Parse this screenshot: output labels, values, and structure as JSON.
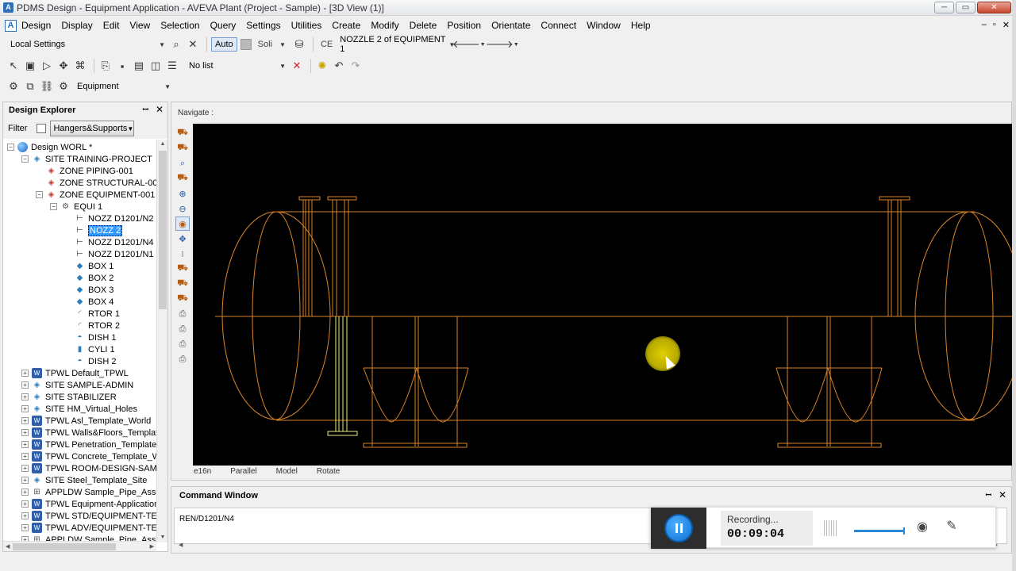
{
  "window": {
    "title": "PDMS Design - Equipment Application - AVEVA Plant (Project - Sample) - [3D View (1)]",
    "app_icon": "A",
    "buttons": {
      "minimize": "─",
      "maximize": "▭",
      "close": "✕"
    }
  },
  "menu": {
    "items": [
      "Design",
      "Display",
      "Edit",
      "View",
      "Selection",
      "Query",
      "Settings",
      "Utilities",
      "Create",
      "Modify",
      "Delete",
      "Position",
      "Orientate",
      "Connect",
      "Window",
      "Help"
    ],
    "mdi_buttons": [
      "–",
      "▫",
      "✕"
    ]
  },
  "toolbar1": {
    "settings_combo": "Local Settings",
    "auto_label": "Auto",
    "solid_label": "Soli",
    "ce_label": "CE",
    "ce_value": "NOZZLE 2 of EQUIPMENT 1"
  },
  "toolbar2": {
    "list_combo": "No list"
  },
  "toolbar3": {
    "application_combo": "Equipment"
  },
  "explorer": {
    "title": "Design Explorer",
    "pin": "📌",
    "close": "✕",
    "filter_label": "Filter",
    "filter_value": "Hangers&Supports",
    "tree": [
      {
        "label": "Design WORL *",
        "level": 0,
        "icon": "globe",
        "exp": "−"
      },
      {
        "label": "SITE TRAINING-PROJECT",
        "level": 1,
        "icon": "site",
        "exp": "−"
      },
      {
        "label": "ZONE PIPING-001",
        "level": 2,
        "icon": "zone",
        "exp": ""
      },
      {
        "label": "ZONE STRUCTURAL-00",
        "level": 2,
        "icon": "zone",
        "exp": ""
      },
      {
        "label": "ZONE EQUIPMENT-001",
        "level": 2,
        "icon": "zone",
        "exp": "−"
      },
      {
        "label": "EQUI 1",
        "level": 3,
        "icon": "equi",
        "exp": "−"
      },
      {
        "label": "NOZZ D1201/N2",
        "level": 4,
        "icon": "nozz",
        "exp": ""
      },
      {
        "label": "NOZZ 2",
        "level": 4,
        "icon": "nozz",
        "exp": "",
        "selected": true
      },
      {
        "label": "NOZZ D1201/N4",
        "level": 4,
        "icon": "nozz",
        "exp": ""
      },
      {
        "label": "NOZZ D1201/N1",
        "level": 4,
        "icon": "nozz",
        "exp": ""
      },
      {
        "label": "BOX 1",
        "level": 4,
        "icon": "box",
        "exp": ""
      },
      {
        "label": "BOX 2",
        "level": 4,
        "icon": "box",
        "exp": ""
      },
      {
        "label": "BOX 3",
        "level": 4,
        "icon": "box",
        "exp": ""
      },
      {
        "label": "BOX 4",
        "level": 4,
        "icon": "box",
        "exp": ""
      },
      {
        "label": "RTOR 1",
        "level": 4,
        "icon": "rtor",
        "exp": ""
      },
      {
        "label": "RTOR 2",
        "level": 4,
        "icon": "rtor",
        "exp": ""
      },
      {
        "label": "DISH 1",
        "level": 4,
        "icon": "dish",
        "exp": ""
      },
      {
        "label": "CYLI 1",
        "level": 4,
        "icon": "cyli",
        "exp": ""
      },
      {
        "label": "DISH 2",
        "level": 4,
        "icon": "dish",
        "exp": ""
      },
      {
        "label": "TPWL Default_TPWL",
        "level": 1,
        "icon": "tpwl",
        "exp": "+"
      },
      {
        "label": "SITE SAMPLE-ADMIN",
        "level": 1,
        "icon": "site",
        "exp": "+"
      },
      {
        "label": "SITE STABILIZER",
        "level": 1,
        "icon": "site",
        "exp": "+"
      },
      {
        "label": "SITE HM_Virtual_Holes",
        "level": 1,
        "icon": "site",
        "exp": "+"
      },
      {
        "label": "TPWL Asl_Template_World",
        "level": 1,
        "icon": "tpwl",
        "exp": "+"
      },
      {
        "label": "TPWL Walls&Floors_Templat",
        "level": 1,
        "icon": "tpwl",
        "exp": "+"
      },
      {
        "label": "TPWL Penetration_Template",
        "level": 1,
        "icon": "tpwl",
        "exp": "+"
      },
      {
        "label": "TPWL Concrete_Template_W",
        "level": 1,
        "icon": "tpwl",
        "exp": "+"
      },
      {
        "label": "TPWL ROOM-DESIGN-SAM",
        "level": 1,
        "icon": "tpwl",
        "exp": "+"
      },
      {
        "label": "SITE Steel_Template_Site",
        "level": 1,
        "icon": "site",
        "exp": "+"
      },
      {
        "label": "APPLDW Sample_Pipe_Asse",
        "level": 1,
        "icon": "appl",
        "exp": "+"
      },
      {
        "label": "TPWL Equipment-Application",
        "level": 1,
        "icon": "tpwl",
        "exp": "+"
      },
      {
        "label": "TPWL STD/EQUIPMENT-TE",
        "level": 1,
        "icon": "tpwl",
        "exp": "+"
      },
      {
        "label": "TPWL ADV/EQUIPMENT-TE",
        "level": 1,
        "icon": "tpwl",
        "exp": "+"
      },
      {
        "label": "APPLDW Sample_Pipe_Asse",
        "level": 1,
        "icon": "appl",
        "exp": "+"
      }
    ]
  },
  "view": {
    "navigate_label": "Navigate :",
    "status": [
      "e16n",
      "Parallel",
      "Model",
      "Rotate"
    ]
  },
  "command_window": {
    "title": "Command Window",
    "output": "REN/D1201/N4"
  },
  "recorder": {
    "status_label": "Recording...",
    "elapsed": "00:09:04",
    "volume": 0.85
  },
  "colors": {
    "model_lines": "#d9852a",
    "selected_nozzle": "#e8f07a",
    "viewport_bg": "#000000",
    "selection": "#3399ff"
  }
}
